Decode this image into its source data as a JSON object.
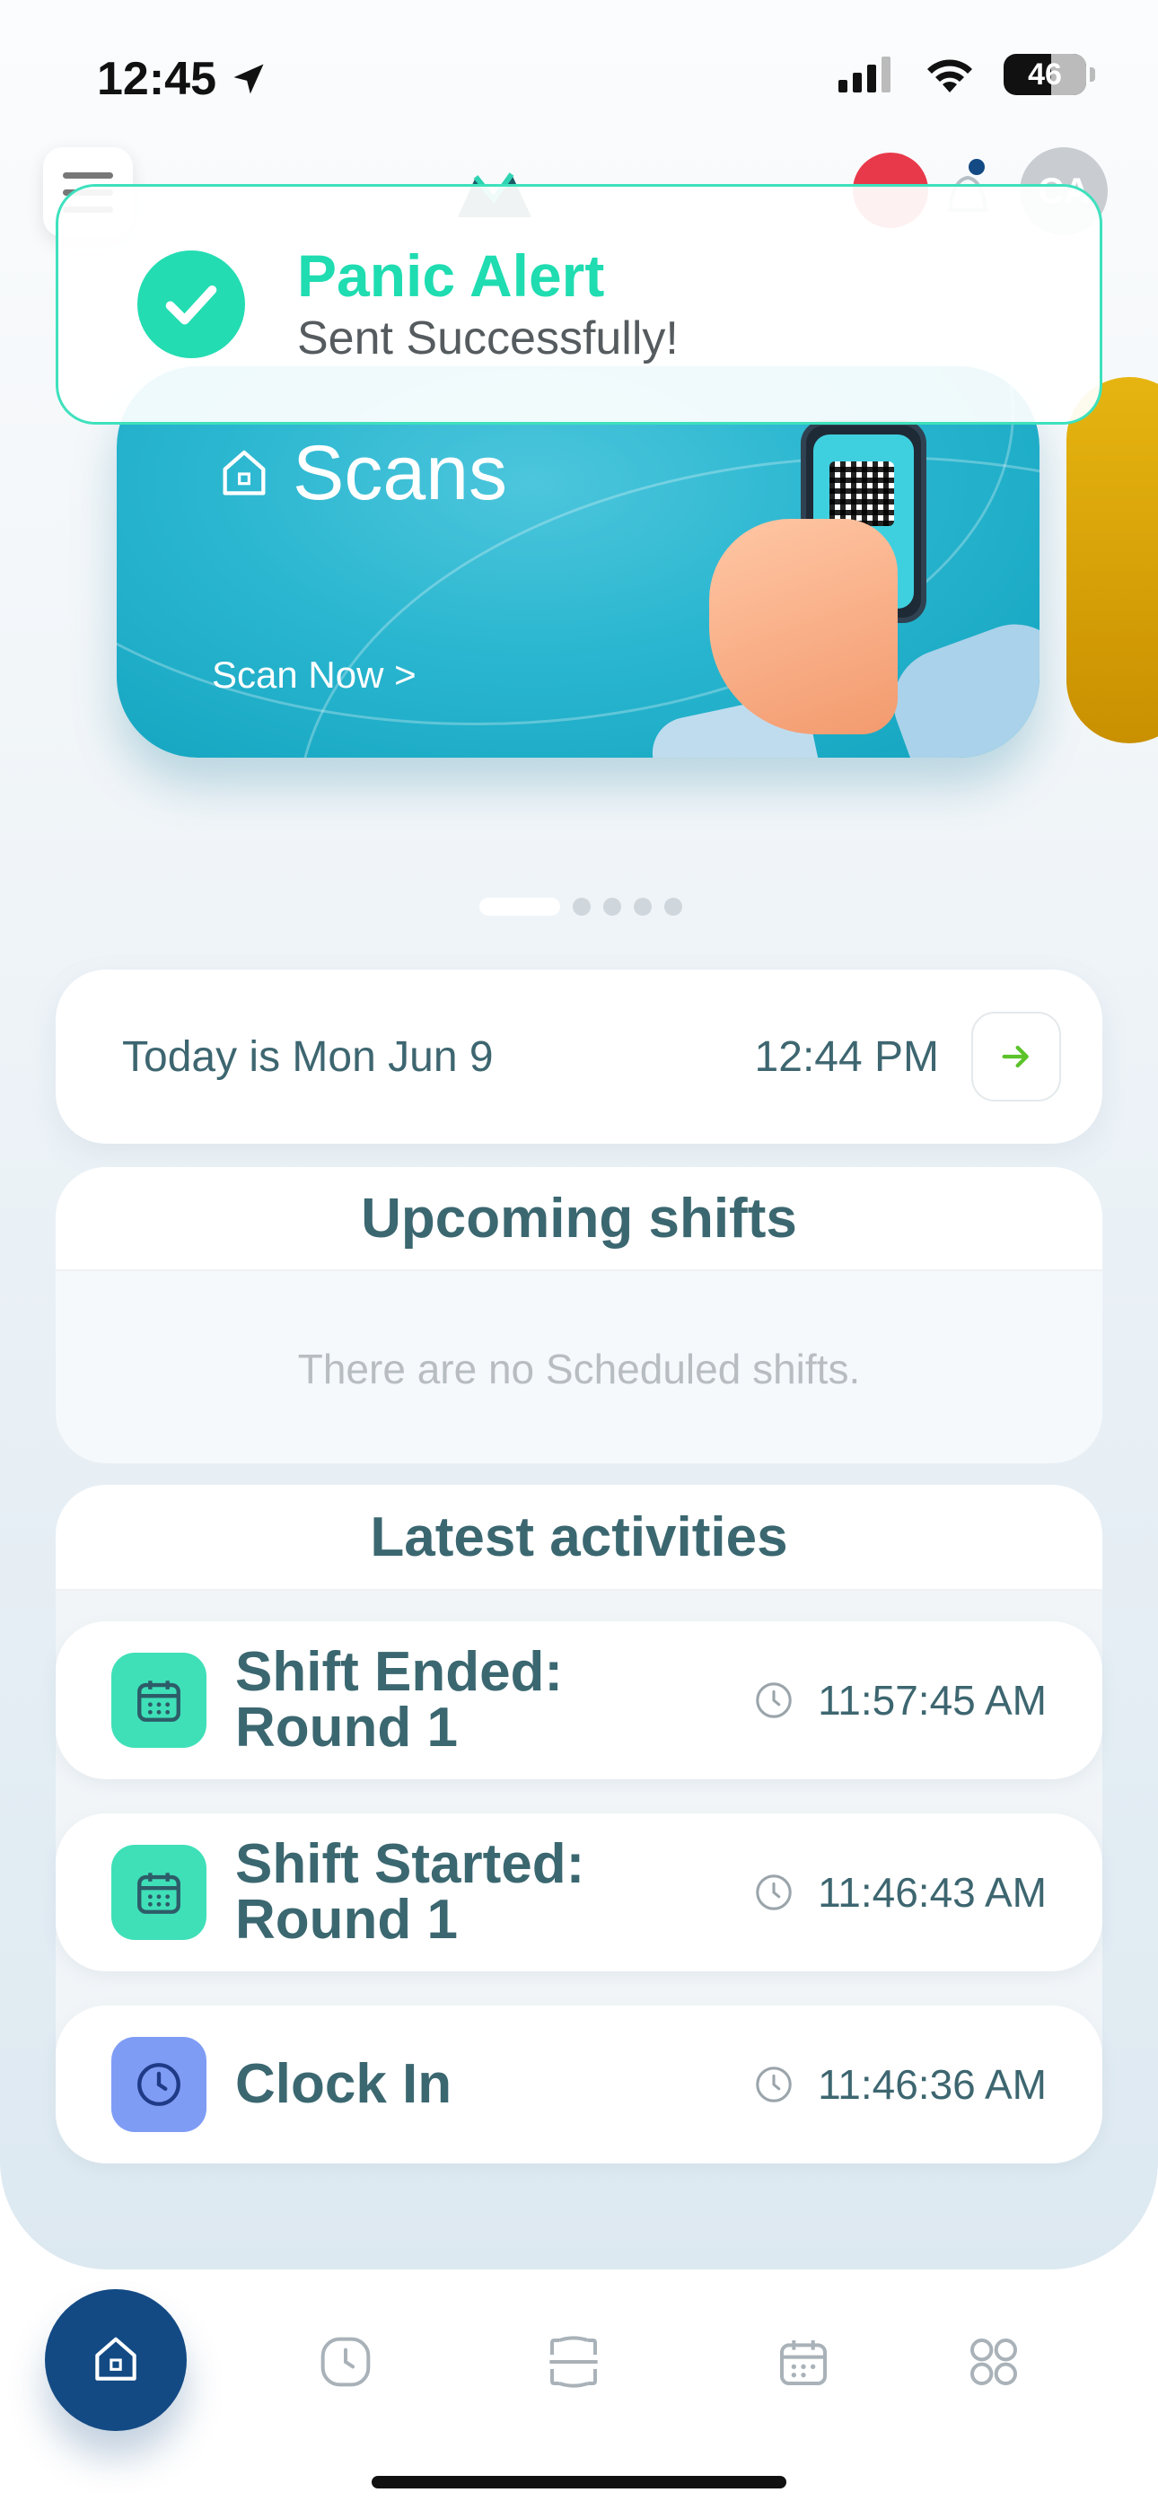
{
  "status_bar": {
    "time": "12:45",
    "battery": "46"
  },
  "header": {
    "avatar_initials": "CA"
  },
  "toast": {
    "title": "Panic Alert",
    "message": "Sent Successfully!"
  },
  "carousel": {
    "card_title": "Scans",
    "card_action": "Scan Now >",
    "card_color": "#17aac6",
    "active_index": 0,
    "dot_count": 5
  },
  "date_card": {
    "date_text": "Today is Mon Jun 9",
    "time_text": "12:44 PM"
  },
  "upcoming_shifts": {
    "title": "Upcoming shifts",
    "empty_message": "There are no Scheduled shifts."
  },
  "latest_activities": {
    "title": "Latest activities",
    "items": [
      {
        "label": "Shift Ended: Round 1",
        "time": "11:57:45 AM",
        "icon": "calendar-icon",
        "icon_color": "#3fe0b8"
      },
      {
        "label": "Shift Started: Round 1",
        "time": "11:46:43 AM",
        "icon": "calendar-icon",
        "icon_color": "#3fe0b8"
      },
      {
        "label": "Clock In",
        "time": "11:46:36 AM",
        "icon": "clock-icon",
        "icon_color": "#7f9cf5"
      }
    ]
  },
  "tab_bar": {
    "tabs": [
      "home-icon",
      "clock-icon",
      "scan-icon",
      "calendar-icon",
      "grid-icon"
    ],
    "active": "home-icon",
    "active_color": "#134a84"
  }
}
